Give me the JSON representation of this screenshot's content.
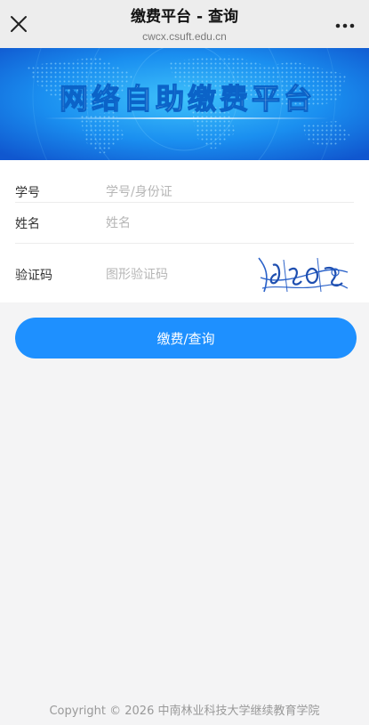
{
  "header": {
    "title": "缴费平台 - 查询",
    "url": "cwcx.csuft.edu.cn",
    "close_icon": "close-icon",
    "more_icon": "more-icon"
  },
  "banner": {
    "title": "网络自助缴费平台",
    "colors": {
      "light": "#36b6f4",
      "dark": "#1565d8"
    }
  },
  "form": {
    "student_id": {
      "label": "学号",
      "placeholder": "学号/身份证",
      "value": ""
    },
    "name": {
      "label": "姓名",
      "placeholder": "姓名",
      "value": ""
    },
    "captcha": {
      "label": "验证码",
      "placeholder": "图形验证码",
      "value": ""
    }
  },
  "submit": {
    "label": "缴费/查询",
    "color": "#1e90ff"
  },
  "footer": {
    "text": "Copyright © 2026  中南林业科技大学继续教育学院"
  }
}
